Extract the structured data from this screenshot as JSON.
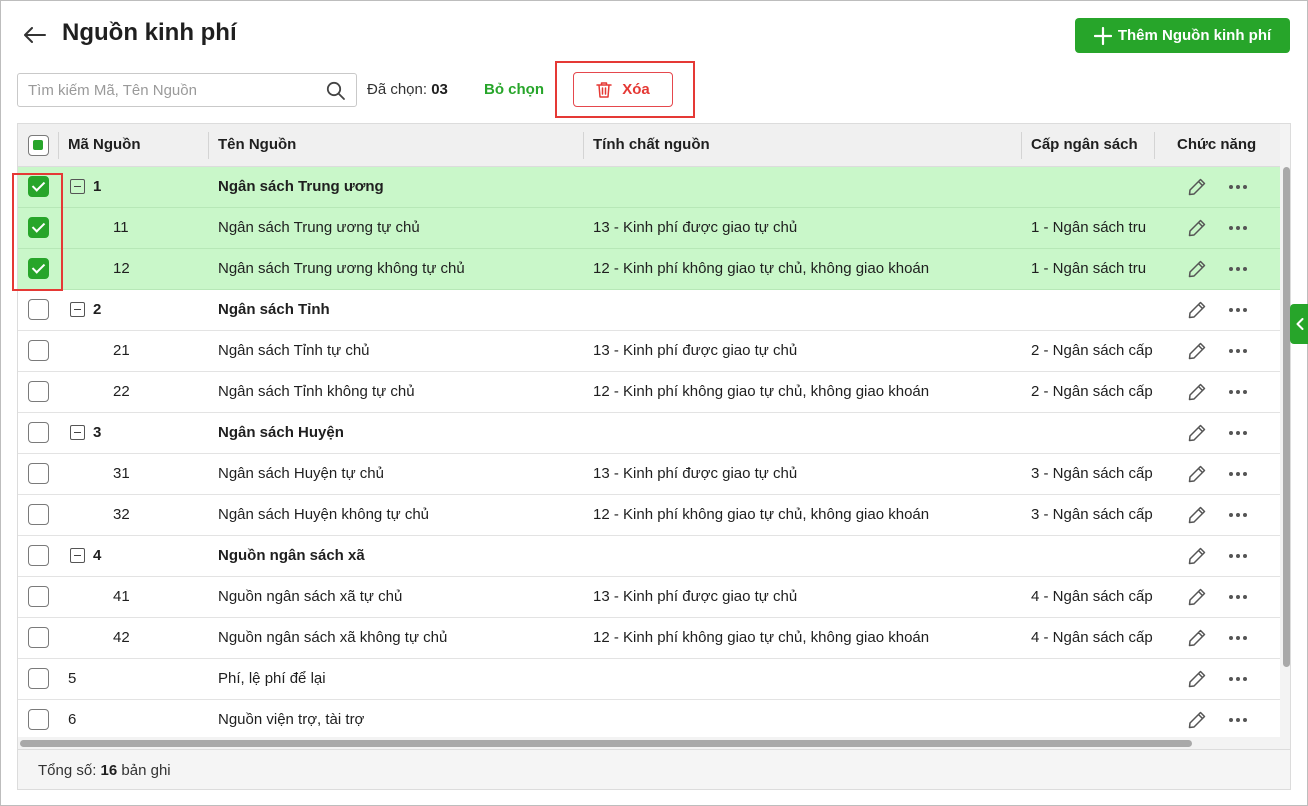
{
  "header": {
    "title": "Nguồn kinh phí",
    "add_button_label": "Thêm Nguồn kinh phí"
  },
  "toolbar": {
    "search_placeholder": "Tìm kiếm Mã, Tên Nguồn",
    "selected_label": "Đã chọn:",
    "selected_count": "03",
    "deselect_label": "Bỏ chọn",
    "delete_label": "Xóa"
  },
  "table": {
    "columns": {
      "code": "Mã Nguồn",
      "name": "Tên Nguồn",
      "nature": "Tính chất nguồn",
      "budget_level": "Cấp ngân sách",
      "actions": "Chức năng"
    },
    "rows": [
      {
        "code": "1",
        "name": "Ngân sách Trung ương",
        "nature": "",
        "budget_level": "",
        "checked": true,
        "group": true
      },
      {
        "code": "11",
        "name": "Ngân sách Trung ương tự chủ",
        "nature": "13 - Kinh phí được giao tự chủ",
        "budget_level": "1 - Ngân sách tru",
        "checked": true,
        "group": false,
        "child": true
      },
      {
        "code": "12",
        "name": "Ngân sách Trung ương không tự chủ",
        "nature": "12 - Kinh phí không giao tự chủ, không giao khoán",
        "budget_level": "1 - Ngân sách tru",
        "checked": true,
        "group": false,
        "child": true
      },
      {
        "code": "2",
        "name": "Ngân sách Tỉnh",
        "nature": "",
        "budget_level": "",
        "checked": false,
        "group": true
      },
      {
        "code": "21",
        "name": "Ngân sách Tỉnh tự chủ",
        "nature": "13 - Kinh phí được giao tự chủ",
        "budget_level": "2 - Ngân sách cấp",
        "checked": false,
        "group": false,
        "child": true
      },
      {
        "code": "22",
        "name": "Ngân sách Tỉnh không tự chủ",
        "nature": "12 - Kinh phí không giao tự chủ, không giao khoán",
        "budget_level": "2 - Ngân sách cấp",
        "checked": false,
        "group": false,
        "child": true
      },
      {
        "code": "3",
        "name": "Ngân sách Huyện",
        "nature": "",
        "budget_level": "",
        "checked": false,
        "group": true
      },
      {
        "code": "31",
        "name": "Ngân sách Huyện tự chủ",
        "nature": "13 - Kinh phí được giao tự chủ",
        "budget_level": "3 - Ngân sách cấp",
        "checked": false,
        "group": false,
        "child": true
      },
      {
        "code": "32",
        "name": "Ngân sách Huyện không tự chủ",
        "nature": "12 - Kinh phí không giao tự chủ, không giao khoán",
        "budget_level": "3 - Ngân sách cấp",
        "checked": false,
        "group": false,
        "child": true
      },
      {
        "code": "4",
        "name": "Nguồn ngân sách xã",
        "nature": "",
        "budget_level": "",
        "checked": false,
        "group": true
      },
      {
        "code": "41",
        "name": "Nguồn ngân sách xã tự chủ",
        "nature": "13 - Kinh phí được giao tự chủ",
        "budget_level": "4 - Ngân sách cấp",
        "checked": false,
        "group": false,
        "child": true
      },
      {
        "code": "42",
        "name": "Nguồn ngân sách xã không tự chủ",
        "nature": "12 - Kinh phí không giao tự chủ, không giao khoán",
        "budget_level": "4 - Ngân sách cấp",
        "checked": false,
        "group": false,
        "child": true
      },
      {
        "code": "5",
        "name": "Phí, lệ phí để lại",
        "nature": "",
        "budget_level": "",
        "checked": false,
        "group": false,
        "child": false
      },
      {
        "code": "6",
        "name": "Nguồn viện trợ, tài trợ",
        "nature": "",
        "budget_level": "",
        "checked": false,
        "group": false,
        "child": false
      }
    ]
  },
  "footer": {
    "total_label": "Tổng số:",
    "total_count": "16",
    "total_unit": "bản ghi"
  },
  "icons": {
    "back": "arrow-left-icon",
    "add": "plus-icon",
    "search": "search-icon",
    "delete": "trash-icon",
    "edit": "pencil-icon",
    "more": "more-horizontal-icon",
    "collapse": "collapse-minus-icon",
    "side_tab": "chevron-left-icon"
  },
  "colors": {
    "primary": "#27a52a",
    "selected_row": "#c9f7c9",
    "danger": "#e53935"
  }
}
